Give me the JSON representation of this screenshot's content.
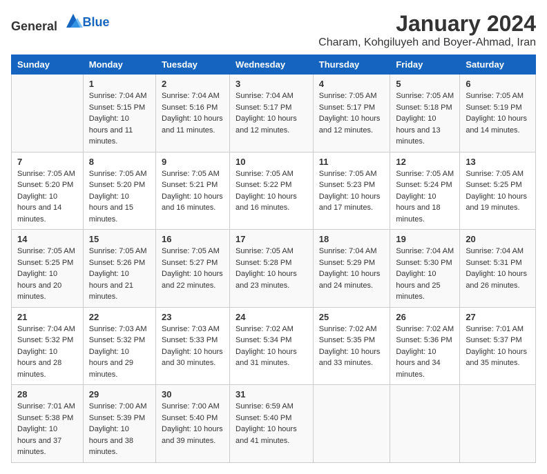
{
  "logo": {
    "general": "General",
    "blue": "Blue"
  },
  "title": "January 2024",
  "subtitle": "Charam, Kohgiluyeh and Boyer-Ahmad, Iran",
  "headers": [
    "Sunday",
    "Monday",
    "Tuesday",
    "Wednesday",
    "Thursday",
    "Friday",
    "Saturday"
  ],
  "weeks": [
    [
      {
        "day": "",
        "sunrise": "",
        "sunset": "",
        "daylight": ""
      },
      {
        "day": "1",
        "sunrise": "Sunrise: 7:04 AM",
        "sunset": "Sunset: 5:15 PM",
        "daylight": "Daylight: 10 hours and 11 minutes."
      },
      {
        "day": "2",
        "sunrise": "Sunrise: 7:04 AM",
        "sunset": "Sunset: 5:16 PM",
        "daylight": "Daylight: 10 hours and 11 minutes."
      },
      {
        "day": "3",
        "sunrise": "Sunrise: 7:04 AM",
        "sunset": "Sunset: 5:17 PM",
        "daylight": "Daylight: 10 hours and 12 minutes."
      },
      {
        "day": "4",
        "sunrise": "Sunrise: 7:05 AM",
        "sunset": "Sunset: 5:17 PM",
        "daylight": "Daylight: 10 hours and 12 minutes."
      },
      {
        "day": "5",
        "sunrise": "Sunrise: 7:05 AM",
        "sunset": "Sunset: 5:18 PM",
        "daylight": "Daylight: 10 hours and 13 minutes."
      },
      {
        "day": "6",
        "sunrise": "Sunrise: 7:05 AM",
        "sunset": "Sunset: 5:19 PM",
        "daylight": "Daylight: 10 hours and 14 minutes."
      }
    ],
    [
      {
        "day": "7",
        "sunrise": "Sunrise: 7:05 AM",
        "sunset": "Sunset: 5:20 PM",
        "daylight": "Daylight: 10 hours and 14 minutes."
      },
      {
        "day": "8",
        "sunrise": "Sunrise: 7:05 AM",
        "sunset": "Sunset: 5:20 PM",
        "daylight": "Daylight: 10 hours and 15 minutes."
      },
      {
        "day": "9",
        "sunrise": "Sunrise: 7:05 AM",
        "sunset": "Sunset: 5:21 PM",
        "daylight": "Daylight: 10 hours and 16 minutes."
      },
      {
        "day": "10",
        "sunrise": "Sunrise: 7:05 AM",
        "sunset": "Sunset: 5:22 PM",
        "daylight": "Daylight: 10 hours and 16 minutes."
      },
      {
        "day": "11",
        "sunrise": "Sunrise: 7:05 AM",
        "sunset": "Sunset: 5:23 PM",
        "daylight": "Daylight: 10 hours and 17 minutes."
      },
      {
        "day": "12",
        "sunrise": "Sunrise: 7:05 AM",
        "sunset": "Sunset: 5:24 PM",
        "daylight": "Daylight: 10 hours and 18 minutes."
      },
      {
        "day": "13",
        "sunrise": "Sunrise: 7:05 AM",
        "sunset": "Sunset: 5:25 PM",
        "daylight": "Daylight: 10 hours and 19 minutes."
      }
    ],
    [
      {
        "day": "14",
        "sunrise": "Sunrise: 7:05 AM",
        "sunset": "Sunset: 5:25 PM",
        "daylight": "Daylight: 10 hours and 20 minutes."
      },
      {
        "day": "15",
        "sunrise": "Sunrise: 7:05 AM",
        "sunset": "Sunset: 5:26 PM",
        "daylight": "Daylight: 10 hours and 21 minutes."
      },
      {
        "day": "16",
        "sunrise": "Sunrise: 7:05 AM",
        "sunset": "Sunset: 5:27 PM",
        "daylight": "Daylight: 10 hours and 22 minutes."
      },
      {
        "day": "17",
        "sunrise": "Sunrise: 7:05 AM",
        "sunset": "Sunset: 5:28 PM",
        "daylight": "Daylight: 10 hours and 23 minutes."
      },
      {
        "day": "18",
        "sunrise": "Sunrise: 7:04 AM",
        "sunset": "Sunset: 5:29 PM",
        "daylight": "Daylight: 10 hours and 24 minutes."
      },
      {
        "day": "19",
        "sunrise": "Sunrise: 7:04 AM",
        "sunset": "Sunset: 5:30 PM",
        "daylight": "Daylight: 10 hours and 25 minutes."
      },
      {
        "day": "20",
        "sunrise": "Sunrise: 7:04 AM",
        "sunset": "Sunset: 5:31 PM",
        "daylight": "Daylight: 10 hours and 26 minutes."
      }
    ],
    [
      {
        "day": "21",
        "sunrise": "Sunrise: 7:04 AM",
        "sunset": "Sunset: 5:32 PM",
        "daylight": "Daylight: 10 hours and 28 minutes."
      },
      {
        "day": "22",
        "sunrise": "Sunrise: 7:03 AM",
        "sunset": "Sunset: 5:32 PM",
        "daylight": "Daylight: 10 hours and 29 minutes."
      },
      {
        "day": "23",
        "sunrise": "Sunrise: 7:03 AM",
        "sunset": "Sunset: 5:33 PM",
        "daylight": "Daylight: 10 hours and 30 minutes."
      },
      {
        "day": "24",
        "sunrise": "Sunrise: 7:02 AM",
        "sunset": "Sunset: 5:34 PM",
        "daylight": "Daylight: 10 hours and 31 minutes."
      },
      {
        "day": "25",
        "sunrise": "Sunrise: 7:02 AM",
        "sunset": "Sunset: 5:35 PM",
        "daylight": "Daylight: 10 hours and 33 minutes."
      },
      {
        "day": "26",
        "sunrise": "Sunrise: 7:02 AM",
        "sunset": "Sunset: 5:36 PM",
        "daylight": "Daylight: 10 hours and 34 minutes."
      },
      {
        "day": "27",
        "sunrise": "Sunrise: 7:01 AM",
        "sunset": "Sunset: 5:37 PM",
        "daylight": "Daylight: 10 hours and 35 minutes."
      }
    ],
    [
      {
        "day": "28",
        "sunrise": "Sunrise: 7:01 AM",
        "sunset": "Sunset: 5:38 PM",
        "daylight": "Daylight: 10 hours and 37 minutes."
      },
      {
        "day": "29",
        "sunrise": "Sunrise: 7:00 AM",
        "sunset": "Sunset: 5:39 PM",
        "daylight": "Daylight: 10 hours and 38 minutes."
      },
      {
        "day": "30",
        "sunrise": "Sunrise: 7:00 AM",
        "sunset": "Sunset: 5:40 PM",
        "daylight": "Daylight: 10 hours and 39 minutes."
      },
      {
        "day": "31",
        "sunrise": "Sunrise: 6:59 AM",
        "sunset": "Sunset: 5:40 PM",
        "daylight": "Daylight: 10 hours and 41 minutes."
      },
      {
        "day": "",
        "sunrise": "",
        "sunset": "",
        "daylight": ""
      },
      {
        "day": "",
        "sunrise": "",
        "sunset": "",
        "daylight": ""
      },
      {
        "day": "",
        "sunrise": "",
        "sunset": "",
        "daylight": ""
      }
    ]
  ]
}
